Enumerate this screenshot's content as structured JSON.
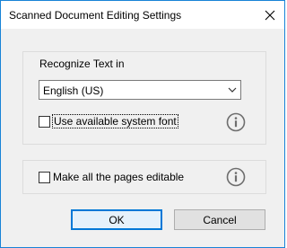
{
  "window": {
    "title": "Scanned Document Editing Settings",
    "close_icon": "close-icon",
    "accent_color": "#1883d7"
  },
  "recognize": {
    "heading": "Recognize Text in",
    "language_selected": "English (US)",
    "system_font_label": "Use available system font",
    "system_font_checked": false
  },
  "editable": {
    "label": "Make all the pages editable",
    "checked": false
  },
  "buttons": {
    "ok_label": "OK",
    "cancel_label": "Cancel"
  },
  "icons": {
    "info": "info-icon",
    "dropdown": "chevron-down-icon"
  }
}
